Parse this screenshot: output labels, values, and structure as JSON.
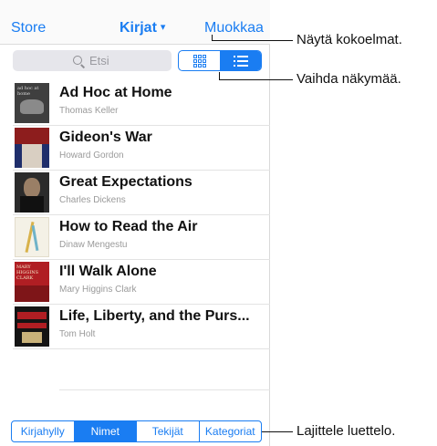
{
  "navbar": {
    "store_label": "Store",
    "title": "Kirjat",
    "caret": "▾",
    "edit_label": "Muokkaa"
  },
  "search": {
    "placeholder": "Etsi"
  },
  "view_toggle": {
    "options": [
      "grid-view",
      "list-view"
    ],
    "selected": "list-view"
  },
  "books": [
    {
      "title": "Ad Hoc at Home",
      "author": "Thomas Keller",
      "cover_colors": [
        "#3b3b3b",
        "#6f6f6f"
      ],
      "cover_text": "ad hoc at home"
    },
    {
      "title": "Gideon's War",
      "author": "Howard Gordon",
      "cover_colors": [
        "#7a1c1c",
        "#2e2e6e"
      ]
    },
    {
      "title": "Great Expectations",
      "author": "Charles Dickens",
      "cover_colors": [
        "#2b2b2b",
        "#5a4636"
      ]
    },
    {
      "title": "How to Read the Air",
      "author": "Dinaw Mengestu",
      "cover_colors": [
        "#f4f1e6",
        "#d8c07a"
      ]
    },
    {
      "title": "I'll Walk Alone",
      "author": "Mary Higgins Clark",
      "cover_colors": [
        "#b01e23",
        "#7e1518"
      ],
      "cover_text": "MARY HIGGINS CLARK"
    },
    {
      "title": "Life, Liberty, and the Purs...",
      "author": "Tom Holt",
      "cover_colors": [
        "#111111",
        "#b01e23"
      ]
    }
  ],
  "sort_tabs": {
    "items": [
      "Kirjahylly",
      "Nimet",
      "Tekijät",
      "Kategoriat"
    ],
    "selected": "Nimet"
  },
  "callouts": {
    "collections": "Näytä kokoelmat.",
    "switch_view": "Vaihda näkymää.",
    "sort_list": "Lajittele luettelo."
  },
  "colors": {
    "accent": "#1a7df2"
  }
}
